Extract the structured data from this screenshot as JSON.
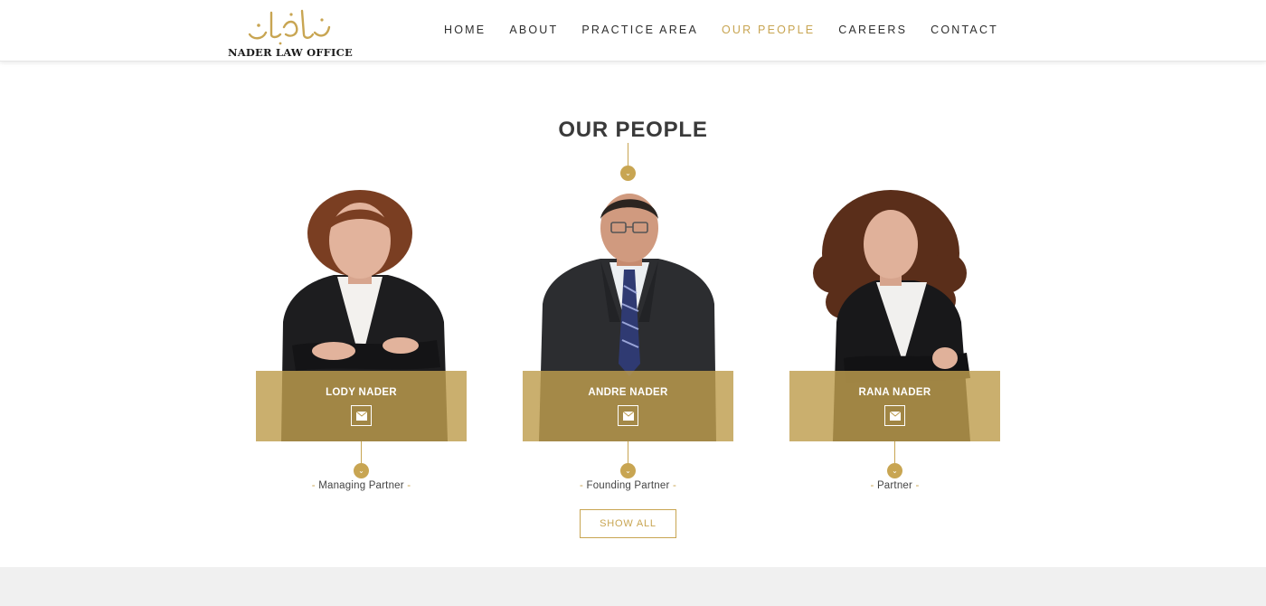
{
  "brand": {
    "logo_text": "NADER LAW OFFICE",
    "logo_arabic": "نادر",
    "accent_color": "#c8a552"
  },
  "nav": {
    "items": [
      {
        "label": "HOME",
        "active": false
      },
      {
        "label": "ABOUT",
        "active": false
      },
      {
        "label": "PRACTICE AREA",
        "active": false
      },
      {
        "label": "OUR PEOPLE",
        "active": true
      },
      {
        "label": "CAREERS",
        "active": false
      },
      {
        "label": "CONTACT",
        "active": false
      }
    ]
  },
  "section": {
    "title": "OUR PEOPLE",
    "divider_icon": "chevron-down-icon"
  },
  "people": [
    {
      "name": "LODY NADER",
      "role": "Managing Partner",
      "contact_icon": "envelope-icon"
    },
    {
      "name": "ANDRE NADER",
      "role": "Founding Partner",
      "contact_icon": "envelope-icon"
    },
    {
      "name": "RANA NADER",
      "role": "Partner",
      "contact_icon": "envelope-icon"
    }
  ],
  "role_dash": "-",
  "show_all_label": "SHOW ALL"
}
